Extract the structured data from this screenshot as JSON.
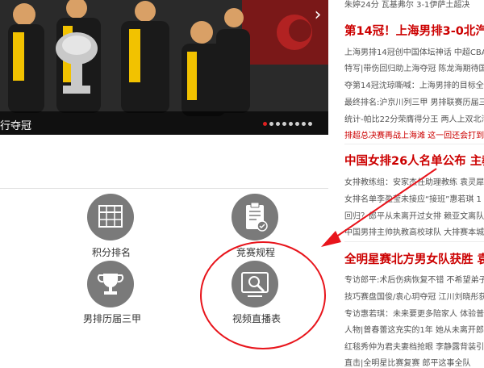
{
  "slider": {
    "caption": "行夺冠",
    "dots_count": 8,
    "active_dot": 0
  },
  "grid": {
    "tiles": [
      {
        "label": "积分排名",
        "icon": "standings-table-icon"
      },
      {
        "label": "竞赛规程",
        "icon": "clipboard-checklist-icon"
      },
      {
        "label": "男排历届三甲",
        "icon": "trophy-icon"
      },
      {
        "label": "视频直播表",
        "icon": "video-schedule-icon"
      }
    ]
  },
  "news": {
    "top_line": "朱婷24分 瓦基弗尔 3-1伊萨土超决",
    "sections": [
      {
        "headline": "第14冠！上海男排3-0北汽 实",
        "lines": [
          {
            "pre": "上海男排14冠创中国体坛神话 中超CBA都",
            "hl": ""
          },
          {
            "pre": "特写|带伤回归助上海夺冠 陈龙海期待国家",
            "hl": ""
          },
          {
            "pre": "夺第14冠沈琼嘶喊：上海男排的目标全超",
            "hl": ""
          },
          {
            "pre": "最终排名:沪京川列三甲 男排联赛历届三",
            "hl": ""
          },
          {
            "pre": "统计-帕比22分荣膺得分王 两人上双北汽",
            "hl": ""
          },
          {
            "pre": "",
            "hl": "排超总决赛再战上海滩 这一回还会打到",
            "post": ""
          }
        ]
      },
      {
        "headline": "中国女排26人名单公布 主教",
        "lines": [
          {
            "pre": "女排教练组：安家杰任助理教练 袁灵犀成",
            "hl": ""
          },
          {
            "pre": "女排名单李盈莹未接应“接班”惠若琪 1",
            "hl": ""
          },
          {
            "pre": "回归？郎平从未离开过女排 赖亚文离队看",
            "hl": ""
          },
          {
            "pre": "中国男排主帅执教高校球队 大排赛本城",
            "hl": ""
          }
        ]
      },
      {
        "headline": "全明星赛北方男女队获胜 袁心",
        "lines": [
          {
            "pre": "专访郎平:术后伤病恢复不错 不希望弟子全",
            "hl": ""
          },
          {
            "pre": "技巧赛盘国俊/袁心玥夺冠 江川刘晓彤获",
            "hl": ""
          },
          {
            "pre": "专访惠若琪：未来要更多陪家人 体验普通",
            "hl": ""
          },
          {
            "pre": "人物|曾春蕾这充实的1年 她从未离开郎平",
            "hl": ""
          },
          {
            "pre": "红毯秀仲为君夫妻档抢眼 李静露背装引侧",
            "hl": ""
          },
          {
            "pre": "直击|全明星比赛复赛 郎平这事全队",
            "hl": ""
          }
        ]
      }
    ]
  },
  "colors": {
    "headline_red": "#cc0000",
    "annotation_red": "#e8141b",
    "icon_grey": "#7a7a7a"
  }
}
